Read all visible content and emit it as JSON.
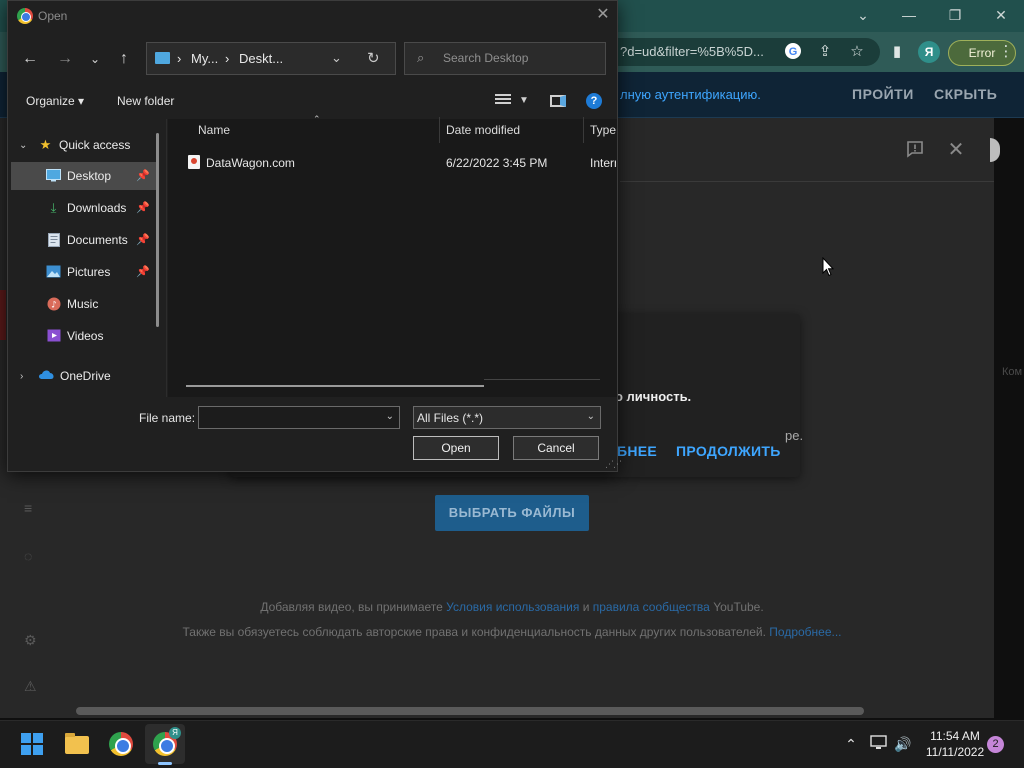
{
  "browser": {
    "url_fragment": "?d=ud&filter=%5B%5D...",
    "profile_initial": "Я",
    "error_chip": "Error",
    "icons": [
      "google-icon",
      "share-icon",
      "star-icon",
      "sidebar-icon"
    ]
  },
  "youtube": {
    "banner_text": "лную аутентификацию.",
    "banner_btn_pass": "ПРОЙТИ",
    "banner_btn_hide": "СКРЫТЬ",
    "verify_title": "о личность.",
    "verify_sub": "ре.",
    "verify_more": "БНЕЕ",
    "verify_continue": "ПРОДОЛЖИТЬ",
    "select_files": "ВЫБРАТЬ ФАЙЛЫ",
    "terms_prefix": "Добавляя видео, вы принимаете ",
    "terms_link1": "Условия использования",
    "terms_and": " и ",
    "terms_link2": "правила сообщества",
    "terms_suffix": " YouTube.",
    "privacy_text": "Также вы обязуетесь соблюдать авторские права и конфиденциальность данных других пользователей. ",
    "privacy_link": "Подробнее...",
    "side_text": "Ком"
  },
  "dialog": {
    "title": "Open",
    "address_seg1": "My...",
    "address_seg2": "Deskt...",
    "search_placeholder": "Search Desktop",
    "organize": "Organize ▾",
    "new_folder": "New folder",
    "help": "?",
    "nav": [
      {
        "label": "Quick access",
        "icon": "star-icon"
      },
      {
        "label": "Desktop",
        "icon": "desktop-icon"
      },
      {
        "label": "Downloads",
        "icon": "download-icon"
      },
      {
        "label": "Documents",
        "icon": "documents-icon"
      },
      {
        "label": "Pictures",
        "icon": "pictures-icon"
      },
      {
        "label": "Music",
        "icon": "music-icon"
      },
      {
        "label": "Videos",
        "icon": "videos-icon"
      },
      {
        "label": "OneDrive",
        "icon": "cloud-icon"
      }
    ],
    "columns": {
      "name": "Name",
      "date": "Date modified",
      "type": "Type"
    },
    "files": [
      {
        "name": "DataWagon.com",
        "date": "6/22/2022 3:45 PM",
        "type": "Intern"
      }
    ],
    "file_name_label": "File name:",
    "file_name_value": "",
    "filter": "All Files (*.*)",
    "open_btn": "Open",
    "cancel_btn": "Cancel"
  },
  "taskbar": {
    "badge": "Я",
    "time": "11:54 AM",
    "date": "11/11/2022",
    "notifications": "2"
  }
}
